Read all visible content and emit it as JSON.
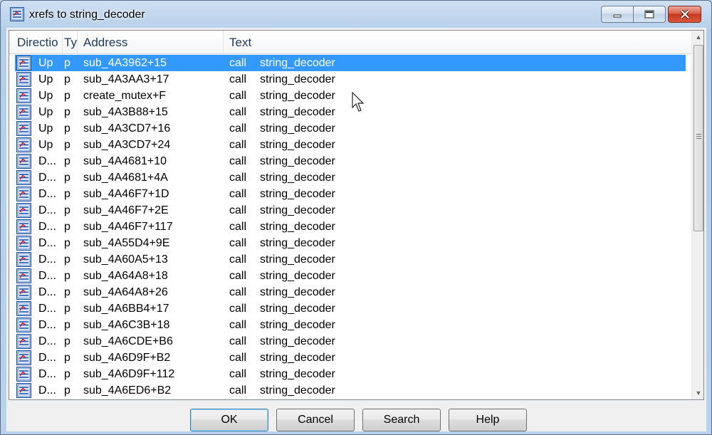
{
  "window": {
    "title": "xrefs to string_decoder"
  },
  "columns": [
    "Directio",
    "Ty",
    "Address",
    "Text"
  ],
  "rows": [
    {
      "dir": "Up",
      "type": "p",
      "address": "sub_4A3962+15",
      "op": "call",
      "target": "string_decoder",
      "selected": true
    },
    {
      "dir": "Up",
      "type": "p",
      "address": "sub_4A3AA3+17",
      "op": "call",
      "target": "string_decoder"
    },
    {
      "dir": "Up",
      "type": "p",
      "address": "create_mutex+F",
      "op": "call",
      "target": "string_decoder"
    },
    {
      "dir": "Up",
      "type": "p",
      "address": "sub_4A3B88+15",
      "op": "call",
      "target": "string_decoder"
    },
    {
      "dir": "Up",
      "type": "p",
      "address": "sub_4A3CD7+16",
      "op": "call",
      "target": "string_decoder"
    },
    {
      "dir": "Up",
      "type": "p",
      "address": "sub_4A3CD7+24",
      "op": "call",
      "target": "string_decoder"
    },
    {
      "dir": "D...",
      "type": "p",
      "address": "sub_4A4681+10",
      "op": "call",
      "target": "string_decoder"
    },
    {
      "dir": "D...",
      "type": "p",
      "address": "sub_4A4681+4A",
      "op": "call",
      "target": "string_decoder"
    },
    {
      "dir": "D...",
      "type": "p",
      "address": "sub_4A46F7+1D",
      "op": "call",
      "target": "string_decoder"
    },
    {
      "dir": "D...",
      "type": "p",
      "address": "sub_4A46F7+2E",
      "op": "call",
      "target": "string_decoder"
    },
    {
      "dir": "D...",
      "type": "p",
      "address": "sub_4A46F7+117",
      "op": "call",
      "target": "string_decoder"
    },
    {
      "dir": "D...",
      "type": "p",
      "address": "sub_4A55D4+9E",
      "op": "call",
      "target": "string_decoder"
    },
    {
      "dir": "D...",
      "type": "p",
      "address": "sub_4A60A5+13",
      "op": "call",
      "target": "string_decoder"
    },
    {
      "dir": "D...",
      "type": "p",
      "address": "sub_4A64A8+18",
      "op": "call",
      "target": "string_decoder"
    },
    {
      "dir": "D...",
      "type": "p",
      "address": "sub_4A64A8+26",
      "op": "call",
      "target": "string_decoder"
    },
    {
      "dir": "D...",
      "type": "p",
      "address": "sub_4A6BB4+17",
      "op": "call",
      "target": "string_decoder"
    },
    {
      "dir": "D...",
      "type": "p",
      "address": "sub_4A6C3B+18",
      "op": "call",
      "target": "string_decoder"
    },
    {
      "dir": "D...",
      "type": "p",
      "address": "sub_4A6CDE+B6",
      "op": "call",
      "target": "string_decoder"
    },
    {
      "dir": "D...",
      "type": "p",
      "address": "sub_4A6D9F+B2",
      "op": "call",
      "target": "string_decoder"
    },
    {
      "dir": "D...",
      "type": "p",
      "address": "sub_4A6D9F+112",
      "op": "call",
      "target": "string_decoder"
    },
    {
      "dir": "D...",
      "type": "p",
      "address": "sub_4A6ED6+B2",
      "op": "call",
      "target": "string_decoder"
    }
  ],
  "buttons": {
    "ok": "OK",
    "cancel": "Cancel",
    "search": "Search",
    "help": "Help"
  },
  "icons": {
    "app": "xref-list-icon",
    "row": "xref-list-icon",
    "minimize": "minimize-icon",
    "maximize": "maximize-icon",
    "close": "close-icon",
    "cursor": "mouse-cursor-icon"
  },
  "colors": {
    "selection": "#3399ff",
    "close_button": "#c7381f"
  }
}
